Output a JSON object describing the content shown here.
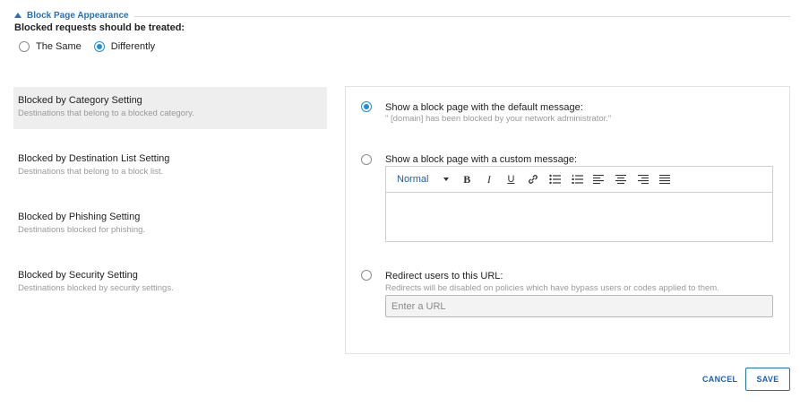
{
  "section": {
    "title": "Block Page Appearance"
  },
  "question": "Blocked requests should be treated:",
  "treatment": {
    "options": [
      "The Same",
      "Differently"
    ],
    "selected": "Differently"
  },
  "categories": [
    {
      "title": "Blocked by Category Setting",
      "desc": "Destinations that belong to a blocked category."
    },
    {
      "title": "Blocked by Destination List Setting",
      "desc": "Destinations that belong to a block list."
    },
    {
      "title": "Blocked by Phishing Setting",
      "desc": "Destinations blocked for phishing."
    },
    {
      "title": "Blocked by Security Setting",
      "desc": "Destinations blocked by security settings."
    }
  ],
  "panel": {
    "default_option": {
      "title": "Show a block page with the default message:",
      "desc": "\" [domain] has been blocked by your network administrator.\""
    },
    "custom_option": {
      "title": "Show a block page with a custom message:"
    },
    "redirect_option": {
      "title": "Redirect users to this URL:",
      "desc": "Redirects will be disabled on policies which have bypass users or codes applied to them."
    },
    "url_placeholder": "Enter a URL",
    "selected": "default"
  },
  "editor": {
    "format": "Normal",
    "toolbar": [
      "bold-icon",
      "italic-icon",
      "underline-icon",
      "link-icon",
      "bullet-list-icon",
      "numbered-list-icon",
      "align-left-icon",
      "align-center-icon",
      "align-right-icon",
      "align-justify-icon"
    ]
  },
  "actions": {
    "cancel": "CANCEL",
    "save": "SAVE"
  },
  "colors": {
    "accent": "#1a73c9",
    "radio": "#1e8ee3"
  }
}
